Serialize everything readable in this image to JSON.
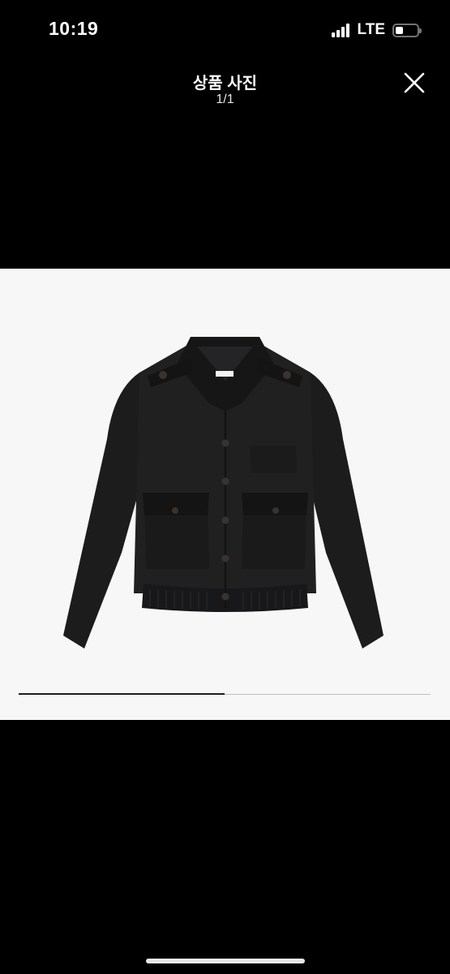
{
  "status_bar": {
    "time": "10:19",
    "network": "LTE",
    "signal_bars": 4,
    "battery_level": 0.35
  },
  "header": {
    "title": "상품 사진",
    "counter": "1/1",
    "close_icon": "close-icon"
  },
  "photo": {
    "subject": "black cropped jacket",
    "background_color": "#f7f7f7",
    "progress": 0.5
  },
  "colors": {
    "background": "#000000",
    "text": "#ffffff"
  }
}
